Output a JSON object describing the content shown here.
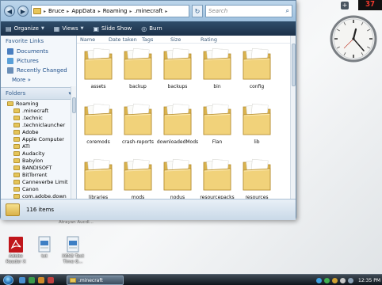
{
  "window": {
    "address": {
      "crumbs": [
        "Bruce",
        "AppData",
        "Roaming",
        ".minecraft"
      ],
      "separator": "▸"
    },
    "search_placeholder": "Search",
    "toolbar": {
      "organize": "Organize",
      "views": "Views",
      "slideshow": "Slide Show",
      "burn": "Burn"
    },
    "nav": {
      "favorites_header": "Favorite Links",
      "favorites": [
        {
          "label": "Documents",
          "color": "#4a7fc0"
        },
        {
          "label": "Pictures",
          "color": "#5aa0d8"
        },
        {
          "label": "Recently Changed",
          "color": "#6b8fb8"
        }
      ],
      "more": "More »",
      "folders_header": "Folders",
      "tree": [
        "Roaming",
        ".minecraft",
        ".technic",
        ".techniclauncher",
        "Adobe",
        "Apple Computer",
        "ATI",
        "Audacity",
        "Babylon",
        "BANDISOFT",
        "BitTorrent",
        "Canneverbe Limit",
        "Canon",
        "com.adobe.down",
        "com.adobe.mauh",
        "Creative"
      ]
    },
    "columns": [
      "Name",
      "Date taken",
      "Tags",
      "Size",
      "Rating"
    ],
    "files": [
      "assets",
      "backup",
      "backups",
      "bin",
      "config",
      "coremods",
      "crash-reports",
      "downloadedMods",
      "Flan",
      "lib",
      "libraries",
      "mods",
      "nodus",
      "resourcepacks",
      "resources"
    ],
    "status": "116 items"
  },
  "desktop": {
    "clock_digital": "37",
    "icons": [
      {
        "label": "Adobe Reader X",
        "kind": "pdf"
      },
      {
        "label": "txt",
        "kind": "doc"
      },
      {
        "label": "X6N3 Text Time G...",
        "kind": "doc"
      }
    ],
    "faded_text": "Atrayan Aucdl..."
  },
  "taskbar": {
    "task_label": ".minecraft",
    "time": "12:35 PM"
  },
  "colors": {
    "titlebar": "#9ec0de",
    "toolbar": "#1c3149",
    "folder": "#f1d27a",
    "taskbar": "#0e151c"
  }
}
